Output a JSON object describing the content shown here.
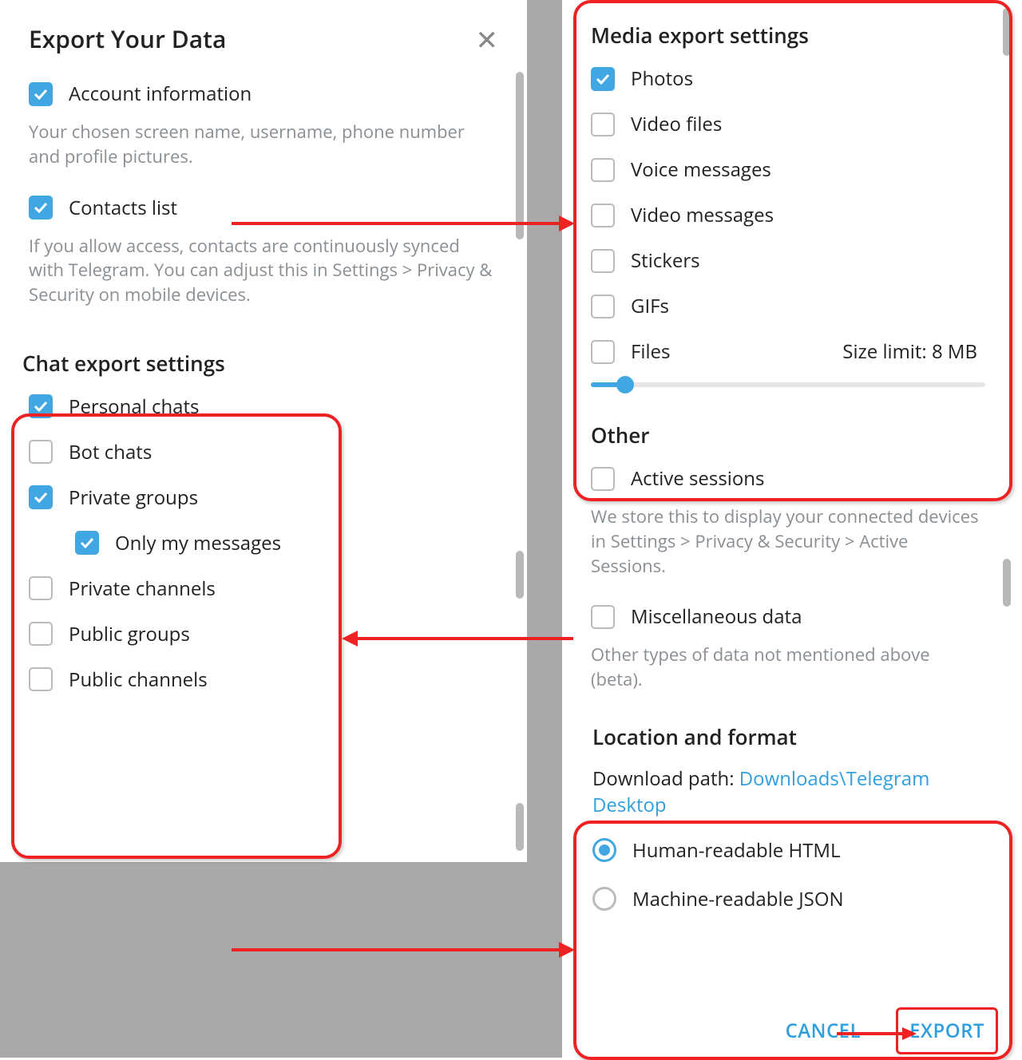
{
  "header": {
    "title": "Export Your Data"
  },
  "account": {
    "label": "Account information",
    "desc": "Your chosen screen name, username, phone number and profile pictures."
  },
  "contacts": {
    "label": "Contacts list",
    "desc": "If you allow access, contacts are continuously synced with Telegram. You can adjust this in Settings > Privacy & Security on mobile devices."
  },
  "chat": {
    "title": "Chat export settings",
    "personal": "Personal chats",
    "bot": "Bot chats",
    "private_groups": "Private groups",
    "only_my": "Only my messages",
    "private_channels": "Private channels",
    "public_groups": "Public groups",
    "public_channels": "Public channels"
  },
  "media": {
    "title": "Media export settings",
    "photos": "Photos",
    "video_files": "Video files",
    "voice": "Voice messages",
    "video_msg": "Video messages",
    "stickers": "Stickers",
    "gifs": "GIFs",
    "files": "Files",
    "size_limit": "Size limit: 8 MB"
  },
  "other": {
    "title": "Other",
    "active": "Active sessions",
    "active_desc": "We store this to display your connected devices in Settings > Privacy & Security > Active Sessions.",
    "misc": "Miscellaneous data",
    "misc_desc": "Other types of data not mentioned above (beta)."
  },
  "location": {
    "title": "Location and format",
    "path_label": "Download path: ",
    "path_value": "Downloads\\Telegram Desktop",
    "html": "Human-readable HTML",
    "json": "Machine-readable JSON"
  },
  "footer": {
    "cancel": "CANCEL",
    "export": "EXPORT"
  }
}
